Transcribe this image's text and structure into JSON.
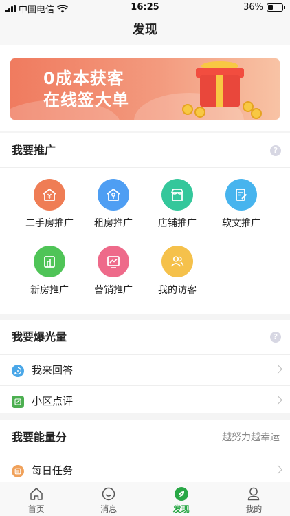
{
  "status_bar": {
    "carrier": "中国电信",
    "time": "16:25",
    "battery": "36%"
  },
  "nav": {
    "title": "发现"
  },
  "banner": {
    "line1": "0成本获客",
    "line2": "在线签大单"
  },
  "promote": {
    "title": "我要推广",
    "help": "?",
    "items": [
      {
        "label": "二手房推广",
        "icon": "house-yen-icon",
        "color": "#ef7d55"
      },
      {
        "label": "租房推广",
        "icon": "house-key-icon",
        "color": "#4e9ef3"
      },
      {
        "label": "店铺推广",
        "icon": "store-icon",
        "color": "#34c79b"
      },
      {
        "label": "软文推广",
        "icon": "edit-note-icon",
        "color": "#47b4ee"
      },
      {
        "label": "新房推广",
        "icon": "building-icon",
        "color": "#4fc457"
      },
      {
        "label": "营销推广",
        "icon": "chart-icon",
        "color": "#ee6a8a"
      },
      {
        "label": "我的访客",
        "icon": "users-icon",
        "color": "#f5c14b"
      }
    ]
  },
  "exposure": {
    "title": "我要爆光量",
    "help": "?",
    "items": [
      {
        "label": "我来回答",
        "icon": "answer-icon",
        "color": "#4aa7e8"
      },
      {
        "label": "小区点评",
        "icon": "review-icon",
        "color": "#4caf50"
      }
    ]
  },
  "energy": {
    "title": "我要能量分",
    "tip": "越努力越幸运",
    "items": [
      {
        "label": "每日任务",
        "icon": "task-icon",
        "color": "#f0a15a"
      }
    ]
  },
  "tabbar": {
    "items": [
      {
        "label": "首页",
        "icon": "home-icon"
      },
      {
        "label": "消息",
        "icon": "message-smile-icon"
      },
      {
        "label": "发现",
        "icon": "leaf-icon",
        "active": true
      },
      {
        "label": "我的",
        "icon": "profile-icon"
      }
    ]
  }
}
